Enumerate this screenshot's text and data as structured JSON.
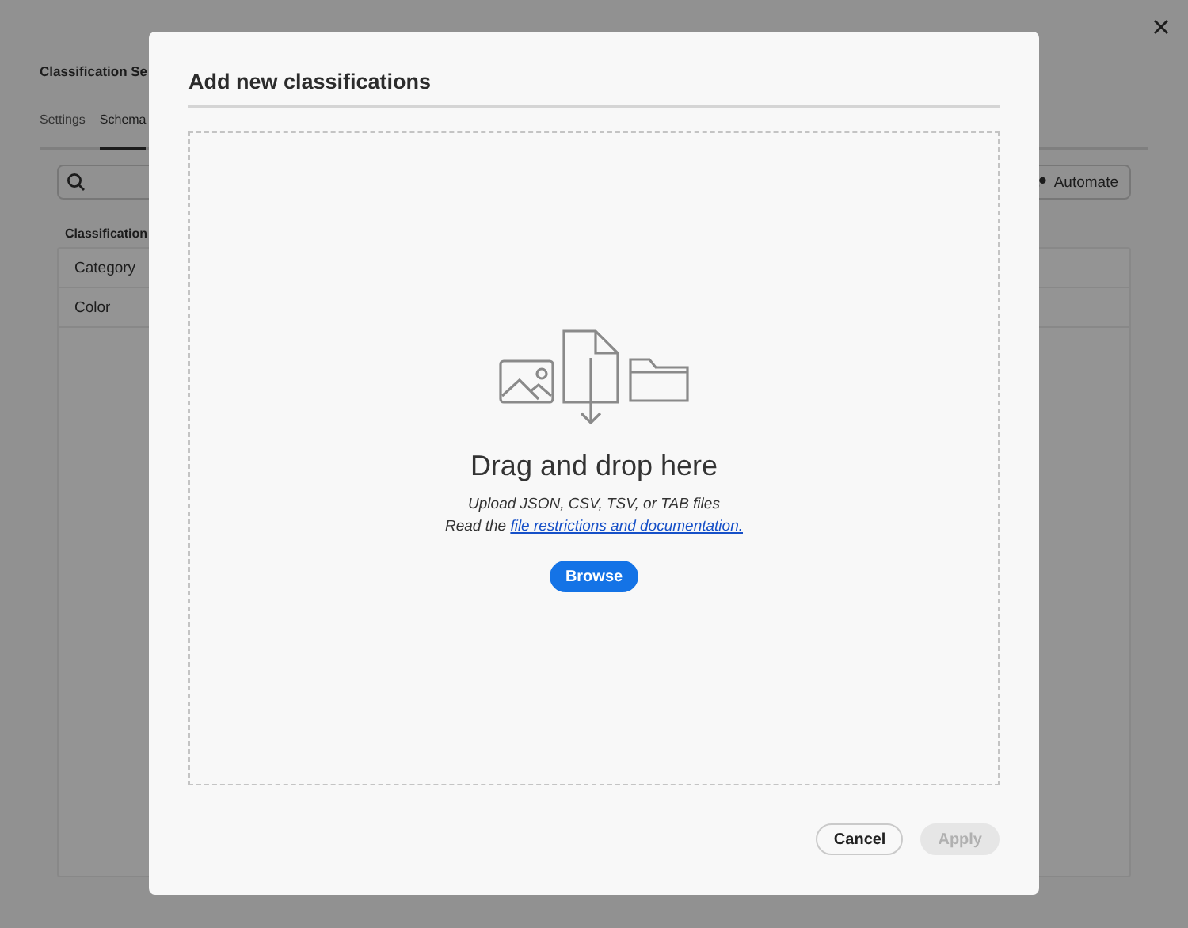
{
  "page": {
    "title": "Classification Se",
    "tabs": [
      {
        "label": "Settings",
        "selected": false
      },
      {
        "label": "Schema",
        "selected": true
      }
    ],
    "automate_button": "Automate",
    "table": {
      "header": "Classification",
      "rows": [
        "Category",
        "Color"
      ]
    }
  },
  "dialog": {
    "title": "Add new classifications",
    "dropzone": {
      "heading": "Drag and drop here",
      "hint": "Upload JSON, CSV, TSV, or TAB files",
      "link_prefix": "Read the ",
      "link": "file restrictions and documentation.",
      "browse_button": "Browse"
    },
    "buttons": [
      {
        "label": "Cancel",
        "disabled": false
      },
      {
        "label": "Apply",
        "disabled": true
      }
    ]
  }
}
